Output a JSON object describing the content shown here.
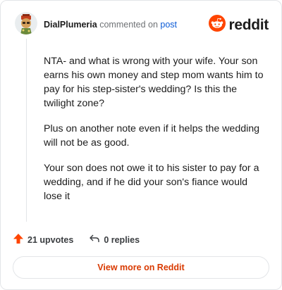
{
  "comment": {
    "author": "DialPlumeria",
    "action_text": "commented on",
    "post_link_text": "post",
    "paragraphs": [
      "NTA- and what is wrong with your wife. Your son earns his own money and step mom wants him to pay for his step-sister's wedding? Is this the twilight zone?",
      "Plus on another note even if it helps the wedding will not be as good.",
      "Your son does not owe it to his sister to pay for a wedding, and if he did your son's fiance would lose it"
    ]
  },
  "brand": {
    "logo_text": "reddit",
    "accent_color": "#ff4500"
  },
  "actions": {
    "upvotes_label": "21 upvotes",
    "replies_label": "0 replies",
    "upvote_color": "#ff4500"
  },
  "footer": {
    "view_more_label": "View more on Reddit",
    "link_color": "#d93a00"
  },
  "icons": [
    "avatar",
    "reddit-snoo-icon",
    "upvote-arrow-icon",
    "reply-icon"
  ]
}
